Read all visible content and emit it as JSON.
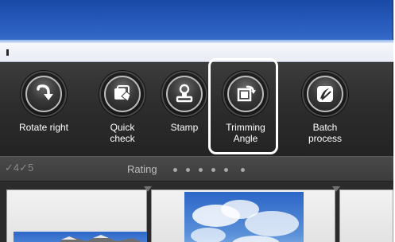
{
  "toolbar": {
    "tools": [
      {
        "label": "Rotate right",
        "icon": "rotate-right-icon"
      },
      {
        "label": "Quick\ncheck",
        "icon": "quick-check-icon"
      },
      {
        "label": "Stamp",
        "icon": "stamp-icon"
      },
      {
        "label": "Trimming\nAngle",
        "icon": "trimming-angle-icon",
        "highlighted": true
      },
      {
        "label": "Batch\nprocess",
        "icon": "batch-process-icon"
      }
    ]
  },
  "rating": {
    "checks_text": "✓4✓5",
    "label": "Rating",
    "stars": 5,
    "value": 0
  },
  "colors": {
    "titlebar_blue": "#2457b8",
    "toolbar_dark": "#2c2c2c",
    "label_white": "#ffffff",
    "highlight": "#ffffff"
  }
}
